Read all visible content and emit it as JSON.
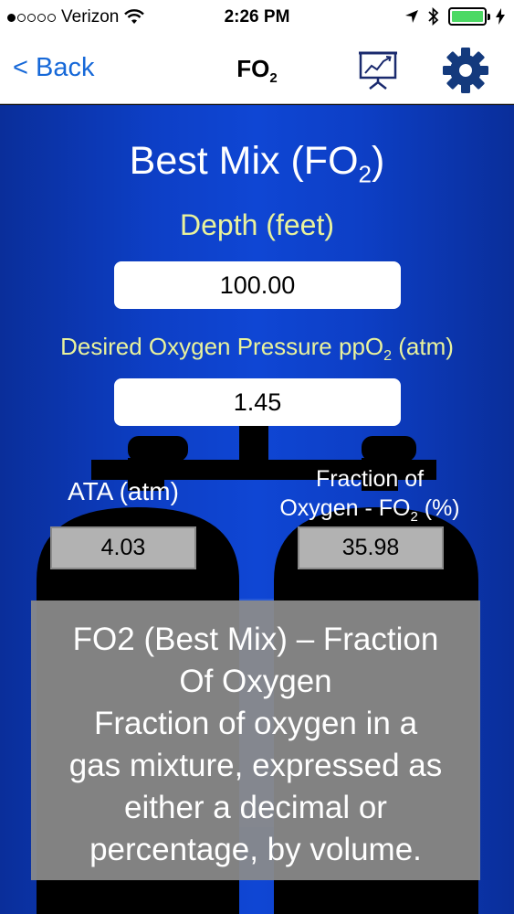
{
  "status_bar": {
    "carrier": "Verizon",
    "time": "2:26 PM"
  },
  "nav": {
    "back_label": "< Back",
    "title_main": "FO",
    "title_sub": "2",
    "chart_icon": "presentation-chart-icon",
    "settings_icon": "gear-icon"
  },
  "main": {
    "title_main": "Best Mix (FO",
    "title_sub": "2",
    "title_end": ")",
    "depth_label": "Depth (feet)",
    "depth_value": "100.00",
    "ppo2_label_main": "Desired Oxygen Pressure ppO",
    "ppo2_label_sub": "2",
    "ppo2_label_end": " (atm)",
    "ppo2_value": "1.45",
    "ata_label": "ATA (atm)",
    "ata_value": "4.03",
    "fo2_label_line1": "Fraction of",
    "fo2_label_line2_main": "Oxygen - FO",
    "fo2_label_line2_sub": "2",
    "fo2_label_line2_end": " (%)",
    "fo2_value": "35.98"
  },
  "tooltip": {
    "lines": [
      "FO2 (Best Mix) – Fraction",
      "Of Oxygen",
      "Fraction of oxygen in a",
      "gas mixture, expressed as",
      "either a decimal or",
      "percentage, by volume."
    ]
  },
  "colors": {
    "accent": "#1668d8",
    "background_blue": "#0f46d4",
    "label_yellow": "#e9f29c",
    "output_gray": "#b2b2b2",
    "battery_green": "#4cd964"
  }
}
